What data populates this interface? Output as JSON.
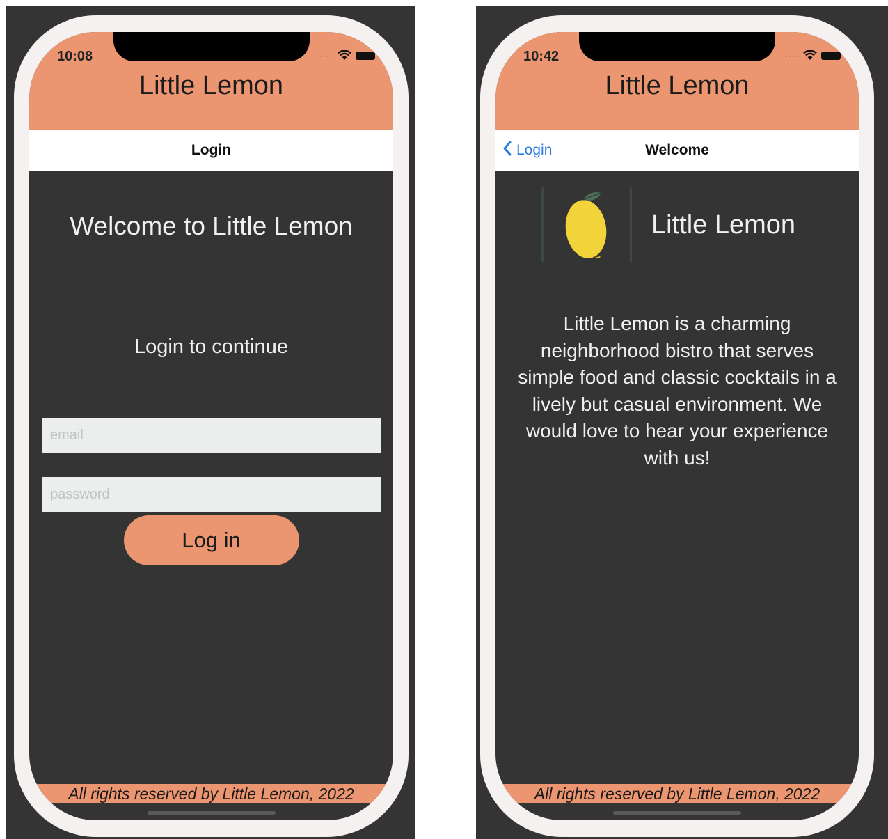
{
  "app_title": "Little Lemon",
  "footer_text": "All rights reserved by Little Lemon, 2022",
  "colors": {
    "accent": "#ec9671",
    "background": "#343434",
    "link": "#2c7de0"
  },
  "login_screen": {
    "status_time": "10:08",
    "nav_title": "Login",
    "welcome_heading": "Welcome to Little Lemon",
    "subheading": "Login to continue",
    "email": {
      "placeholder": "email",
      "value": ""
    },
    "password": {
      "placeholder": "password",
      "value": ""
    },
    "login_button": "Log in"
  },
  "welcome_screen": {
    "status_time": "10:42",
    "nav_title": "Welcome",
    "back_label": "Login",
    "logo_icon": "lemon-icon",
    "logo_text": "Little Lemon",
    "description": "Little Lemon is a charming neighborhood bistro that serves simple food and classic cocktails in a lively but casual environment. We would love to hear your experience with us!"
  }
}
